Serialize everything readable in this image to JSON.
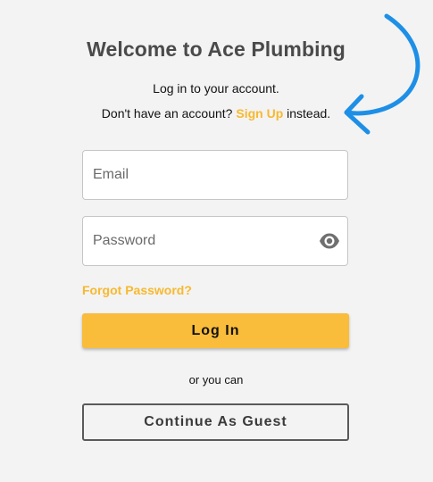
{
  "header": {
    "title": "Welcome to Ace Plumbing",
    "subtitle": "Log in to your account."
  },
  "signup": {
    "prefix": "Don't have an account?",
    "link_label": "Sign Up",
    "suffix": "instead."
  },
  "form": {
    "email_placeholder": "Email",
    "password_placeholder": "Password",
    "show_password_icon": "eye-icon",
    "forgot_label": "Forgot Password?",
    "login_label": "Log In",
    "divider_text": "or you can",
    "guest_label": "Continue As Guest"
  },
  "annotation": {
    "icon": "curved-arrow-icon",
    "color": "#1e8fe6"
  },
  "colors": {
    "accent": "#f7b92f",
    "button": "#f9bc3b",
    "background": "#f3f3f3"
  }
}
